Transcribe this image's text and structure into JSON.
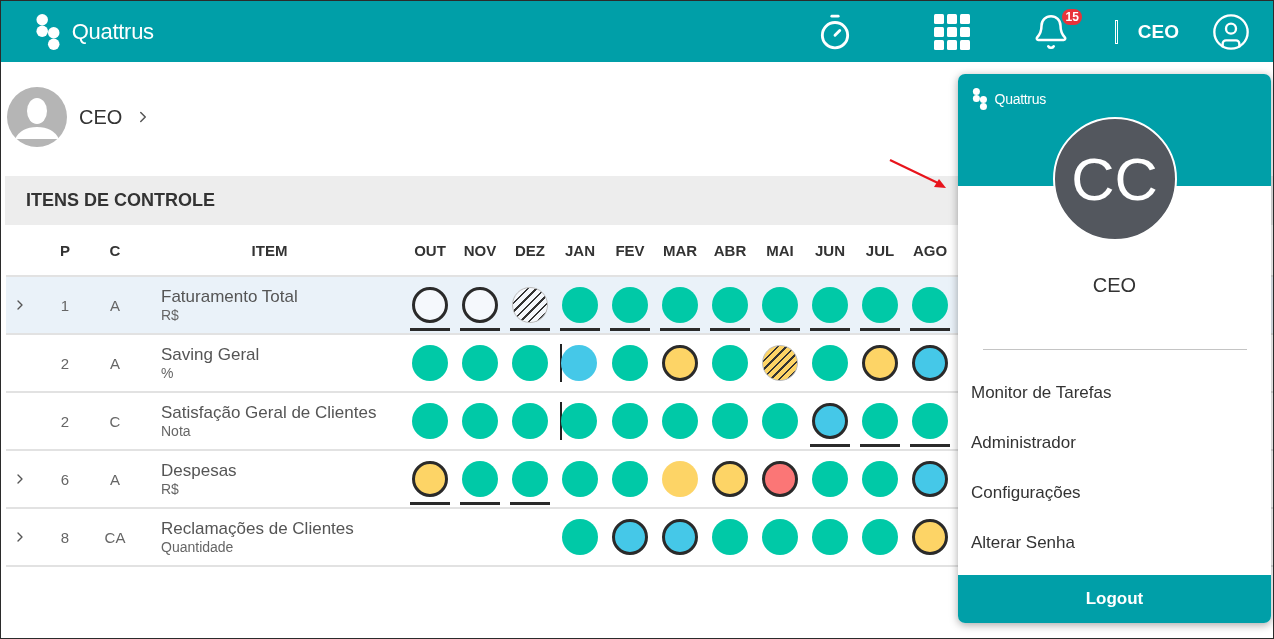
{
  "topbar": {
    "brand": "Quattrus",
    "notifications": "15",
    "role": "CEO"
  },
  "profile": {
    "name": "CEO"
  },
  "section": {
    "title": "ITENS DE CONTROLE"
  },
  "table": {
    "columns": [
      "P",
      "C",
      "ITEM"
    ],
    "months": [
      "OUT",
      "NOV",
      "DEZ",
      "JAN",
      "FEV",
      "MAR",
      "ABR",
      "MAI",
      "JUN",
      "JUL",
      "AGO"
    ],
    "rows": [
      {
        "expandable": true,
        "selected": true,
        "p": "1",
        "c": "A",
        "item": "Faturamento Total",
        "unit": "R$",
        "cells": [
          {
            "color": "#f5f8fc",
            "kind": "outlined",
            "underlined": true,
            "divider_before": false
          },
          {
            "color": "#f5f8fc",
            "kind": "outlined",
            "underlined": true,
            "divider_before": false
          },
          {
            "color": "#f5f8fc",
            "kind": "striped",
            "underlined": true,
            "divider_before": false
          },
          {
            "color": "#00c9a7",
            "kind": "filled",
            "underlined": true,
            "divider_before": false
          },
          {
            "color": "#00c9a7",
            "kind": "filled",
            "underlined": true,
            "divider_before": false
          },
          {
            "color": "#00c9a7",
            "kind": "filled",
            "underlined": true,
            "divider_before": false
          },
          {
            "color": "#00c9a7",
            "kind": "filled",
            "underlined": true,
            "divider_before": false
          },
          {
            "color": "#00c9a7",
            "kind": "filled",
            "underlined": true,
            "divider_before": false
          },
          {
            "color": "#00c9a7",
            "kind": "filled",
            "underlined": true,
            "divider_before": false
          },
          {
            "color": "#00c9a7",
            "kind": "filled",
            "underlined": true,
            "divider_before": false
          },
          {
            "color": "#00c9a7",
            "kind": "filled",
            "underlined": true,
            "divider_before": false
          }
        ]
      },
      {
        "expandable": false,
        "selected": false,
        "p": "2",
        "c": "A",
        "item": "Saving Geral",
        "unit": "%",
        "cells": [
          {
            "color": "#00c9a7",
            "kind": "filled",
            "underlined": false,
            "divider_before": false
          },
          {
            "color": "#00c9a7",
            "kind": "filled",
            "underlined": false,
            "divider_before": false
          },
          {
            "color": "#00c9a7",
            "kind": "filled",
            "underlined": false,
            "divider_before": false
          },
          {
            "color": "#45c8e8",
            "kind": "filled",
            "underlined": false,
            "divider_before": true
          },
          {
            "color": "#00c9a7",
            "kind": "filled",
            "underlined": false,
            "divider_before": false
          },
          {
            "color": "#fdd466",
            "kind": "outlined",
            "underlined": false,
            "divider_before": false
          },
          {
            "color": "#00c9a7",
            "kind": "filled",
            "underlined": false,
            "divider_before": false
          },
          {
            "color": "#fdd466",
            "kind": "striped",
            "underlined": false,
            "divider_before": false
          },
          {
            "color": "#00c9a7",
            "kind": "filled",
            "underlined": false,
            "divider_before": false
          },
          {
            "color": "#fdd466",
            "kind": "outlined",
            "underlined": false,
            "divider_before": false
          },
          {
            "color": "#45c8e8",
            "kind": "outlined",
            "underlined": false,
            "divider_before": false
          }
        ]
      },
      {
        "expandable": false,
        "selected": false,
        "p": "2",
        "c": "C",
        "item": "Satisfação Geral de Clientes",
        "unit": "Nota",
        "cells": [
          {
            "color": "#00c9a7",
            "kind": "filled",
            "underlined": false,
            "divider_before": false
          },
          {
            "color": "#00c9a7",
            "kind": "filled",
            "underlined": false,
            "divider_before": false
          },
          {
            "color": "#00c9a7",
            "kind": "filled",
            "underlined": false,
            "divider_before": false
          },
          {
            "color": "#00c9a7",
            "kind": "filled",
            "underlined": false,
            "divider_before": true
          },
          {
            "color": "#00c9a7",
            "kind": "filled",
            "underlined": false,
            "divider_before": false
          },
          {
            "color": "#00c9a7",
            "kind": "filled",
            "underlined": false,
            "divider_before": false
          },
          {
            "color": "#00c9a7",
            "kind": "filled",
            "underlined": false,
            "divider_before": false
          },
          {
            "color": "#00c9a7",
            "kind": "filled",
            "underlined": false,
            "divider_before": false
          },
          {
            "color": "#45c8e8",
            "kind": "outlined",
            "underlined": true,
            "divider_before": false
          },
          {
            "color": "#00c9a7",
            "kind": "filled",
            "underlined": true,
            "divider_before": false
          },
          {
            "color": "#00c9a7",
            "kind": "filled",
            "underlined": true,
            "divider_before": false
          }
        ]
      },
      {
        "expandable": true,
        "selected": false,
        "p": "6",
        "c": "A",
        "item": "Despesas",
        "unit": "R$",
        "cells": [
          {
            "color": "#fdd466",
            "kind": "outlined",
            "underlined": true,
            "divider_before": false
          },
          {
            "color": "#00c9a7",
            "kind": "filled",
            "underlined": true,
            "divider_before": false
          },
          {
            "color": "#00c9a7",
            "kind": "filled",
            "underlined": true,
            "divider_before": false
          },
          {
            "color": "#00c9a7",
            "kind": "filled",
            "underlined": false,
            "divider_before": false
          },
          {
            "color": "#00c9a7",
            "kind": "filled",
            "underlined": false,
            "divider_before": false
          },
          {
            "color": "#fdd466",
            "kind": "filled",
            "underlined": false,
            "divider_before": false
          },
          {
            "color": "#fdd466",
            "kind": "outlined",
            "underlined": false,
            "divider_before": false
          },
          {
            "color": "#fb7676",
            "kind": "outlined",
            "underlined": false,
            "divider_before": false
          },
          {
            "color": "#00c9a7",
            "kind": "filled",
            "underlined": false,
            "divider_before": false
          },
          {
            "color": "#00c9a7",
            "kind": "filled",
            "underlined": false,
            "divider_before": false
          },
          {
            "color": "#45c8e8",
            "kind": "outlined",
            "underlined": false,
            "divider_before": false
          }
        ]
      },
      {
        "expandable": true,
        "selected": false,
        "p": "8",
        "c": "CA",
        "item": "Reclamações de Clientes",
        "unit": "Quantidade",
        "cells": [
          null,
          null,
          null,
          {
            "color": "#00c9a7",
            "kind": "filled",
            "underlined": false,
            "divider_before": false
          },
          {
            "color": "#45c8e8",
            "kind": "outlined",
            "underlined": false,
            "divider_before": false
          },
          {
            "color": "#45c8e8",
            "kind": "outlined",
            "underlined": false,
            "divider_before": false
          },
          {
            "color": "#00c9a7",
            "kind": "filled",
            "underlined": false,
            "divider_before": false
          },
          {
            "color": "#00c9a7",
            "kind": "filled",
            "underlined": false,
            "divider_before": false
          },
          {
            "color": "#00c9a7",
            "kind": "filled",
            "underlined": false,
            "divider_before": false
          },
          {
            "color": "#00c9a7",
            "kind": "filled",
            "underlined": false,
            "divider_before": false
          },
          {
            "color": "#fdd466",
            "kind": "outlined",
            "underlined": false,
            "divider_before": false
          }
        ]
      }
    ]
  },
  "user_menu": {
    "brand": "Quattrus",
    "initials": "CC",
    "name": "CEO",
    "items": [
      "Monitor de Tarefas",
      "Administrador",
      "Configurações",
      "Alterar Senha"
    ],
    "logout": "Logout"
  }
}
